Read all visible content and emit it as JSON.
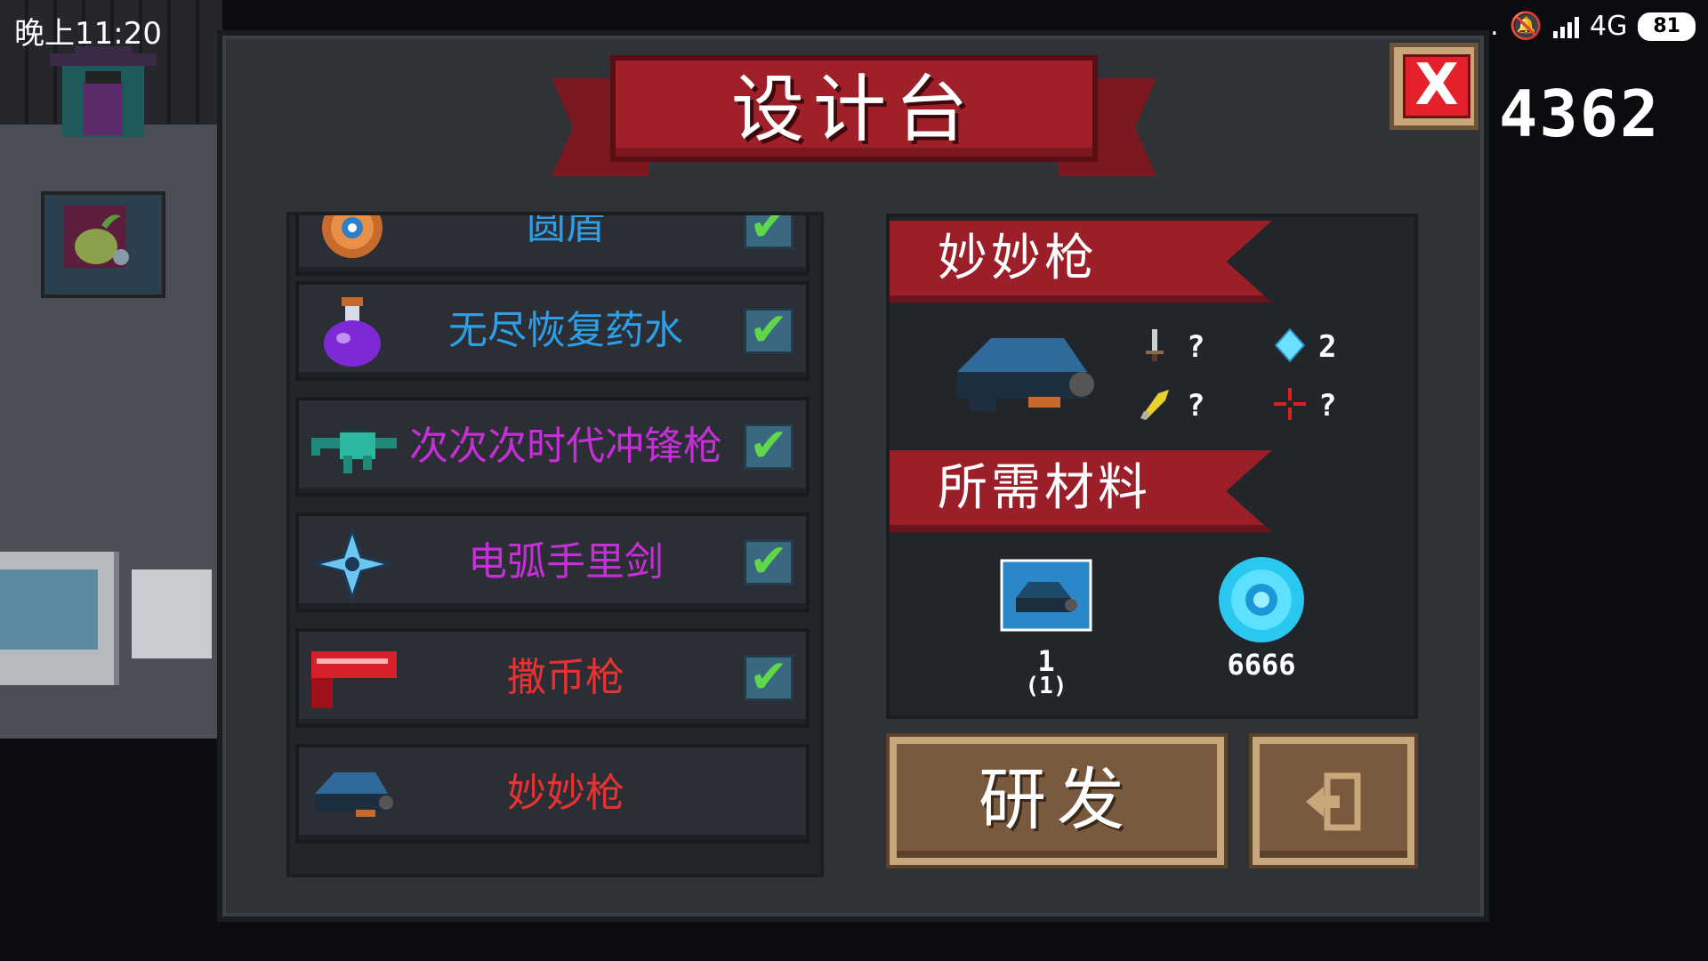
{
  "status_bar": {
    "time": "晚上11:20",
    "dots": "...",
    "network": "4G",
    "battery": "81"
  },
  "currency": {
    "amount": "4362"
  },
  "dialog": {
    "title": "设计台",
    "close_label": "X"
  },
  "recipes": [
    {
      "label": "圆盾",
      "icon": "round-shield-icon",
      "color": "#2f9ee8",
      "checked": true
    },
    {
      "label": "无尽恢复药水",
      "icon": "purple-potion-icon",
      "color": "#2f9ee8",
      "checked": true
    },
    {
      "label": "次次次时代冲锋枪",
      "icon": "teal-smg-icon",
      "color": "#c52fd6",
      "checked": true
    },
    {
      "label": "电弧手里剑",
      "icon": "shuriken-icon",
      "color": "#c52fd6",
      "checked": true
    },
    {
      "label": "撒币枪",
      "icon": "red-coin-gun-icon",
      "color": "#e83232",
      "checked": true
    },
    {
      "label": "妙妙枪",
      "icon": "blue-gun-icon",
      "color": "#e83232",
      "checked": false
    }
  ],
  "detail": {
    "weapon_name": "妙妙枪",
    "stats": {
      "damage": "?",
      "energy": "2",
      "crit": "?",
      "accuracy": "?"
    },
    "materials_title": "所需材料",
    "materials": [
      {
        "icon": "blueprint-icon",
        "count": "1",
        "owned": "(1)"
      },
      {
        "icon": "blue-gem-coin-icon",
        "count": "6666"
      }
    ]
  },
  "buttons": {
    "develop": "研发",
    "exit_icon": "exit-icon"
  },
  "colors": {
    "banner_red": "#a0202a",
    "panel_bg": "#2f3338",
    "button_brown": "#7a5a3f",
    "check_green": "#5ed84a"
  }
}
